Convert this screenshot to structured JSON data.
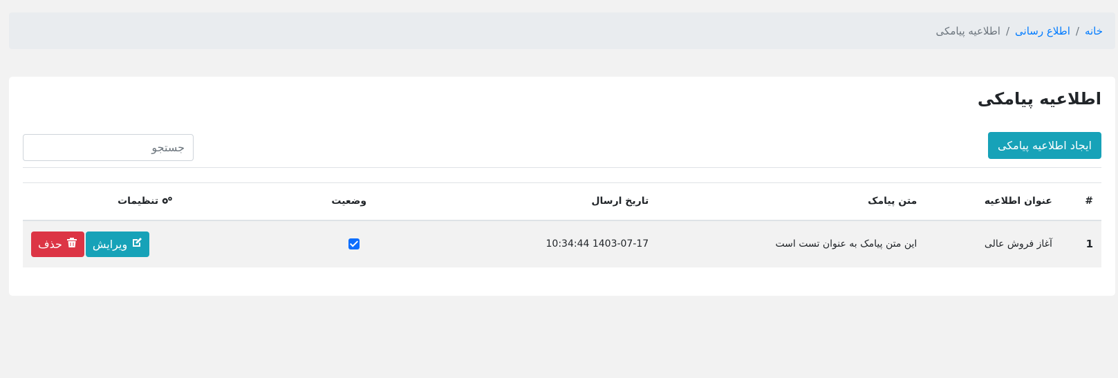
{
  "breadcrumb": {
    "home": "خانه",
    "separator": "/",
    "section": "اطلاع رسانی",
    "current": "اطلاعیه پیامکی"
  },
  "page": {
    "title": "اطلاعیه پیامکی",
    "create_button": "ایجاد اطلاعیه پیامکی",
    "search_placeholder": "جستجو"
  },
  "table": {
    "columns": {
      "index": "#",
      "title": "عنوان اطلاعیه",
      "text": "متن پیامک",
      "date": "تاریخ ارسال",
      "status": "وضعیت",
      "settings": "تنظیمات"
    },
    "rows": [
      {
        "index": "1",
        "title": "آغاز فروش عالی",
        "text": "این متن پیامک به عنوان تست است",
        "date": "1403-07-17 10:34:44",
        "status_checked": true,
        "edit_label": "ویرایش",
        "delete_label": "حذف"
      }
    ]
  },
  "icons": {
    "settings": "gears-icon",
    "edit": "edit-icon",
    "delete": "trash-icon"
  },
  "colors": {
    "info": "#17a2b8",
    "danger": "#dc3545",
    "link": "#007bff",
    "checkbox": "#0d6efd"
  }
}
